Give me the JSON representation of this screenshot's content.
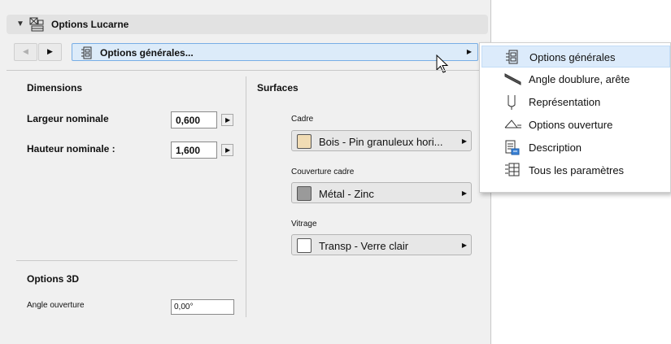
{
  "panel": {
    "title": "Options Lucarne",
    "collapse_glyph": "▼",
    "nav_prev_glyph": "◀",
    "nav_next_glyph": "▶",
    "page_select": {
      "label": "Options générales...",
      "arrow": "▶"
    }
  },
  "dimensions": {
    "heading": "Dimensions",
    "width_label": "Largeur nominale",
    "width_value": "0,600",
    "height_label": "Hauteur nominale :",
    "height_value": "1,600",
    "arrow": "▶"
  },
  "options3d": {
    "heading": "Options 3D",
    "angle_label": "Angle ouverture",
    "angle_value": "0,00°"
  },
  "surfaces": {
    "heading": "Surfaces",
    "items": [
      {
        "label": "Cadre",
        "material": "Bois - Pin granuleux hori...",
        "swatch": "#f1dcb4"
      },
      {
        "label": "Couverture cadre",
        "material": "Métal - Zinc",
        "swatch": "#9a9a9a"
      },
      {
        "label": "Vitrage",
        "material": "Transp - Verre clair",
        "swatch": "#ffffff"
      }
    ],
    "arrow": "▶"
  },
  "menu": {
    "items": [
      {
        "label": "Options générales",
        "icon": "general-options-icon",
        "selected": true
      },
      {
        "label": "Angle doublure, arête",
        "icon": "angle-lining-icon"
      },
      {
        "label": "Représentation",
        "icon": "representation-icon"
      },
      {
        "label": "Options ouverture",
        "icon": "opening-options-icon"
      },
      {
        "label": "Description",
        "icon": "description-icon"
      },
      {
        "label": "Tous les paramètres",
        "icon": "all-parameters-icon"
      }
    ]
  },
  "colors": {
    "selection_bg": "#dcebf9",
    "selection_border": "#78aee5",
    "panel_bg": "#f0f0f0"
  }
}
